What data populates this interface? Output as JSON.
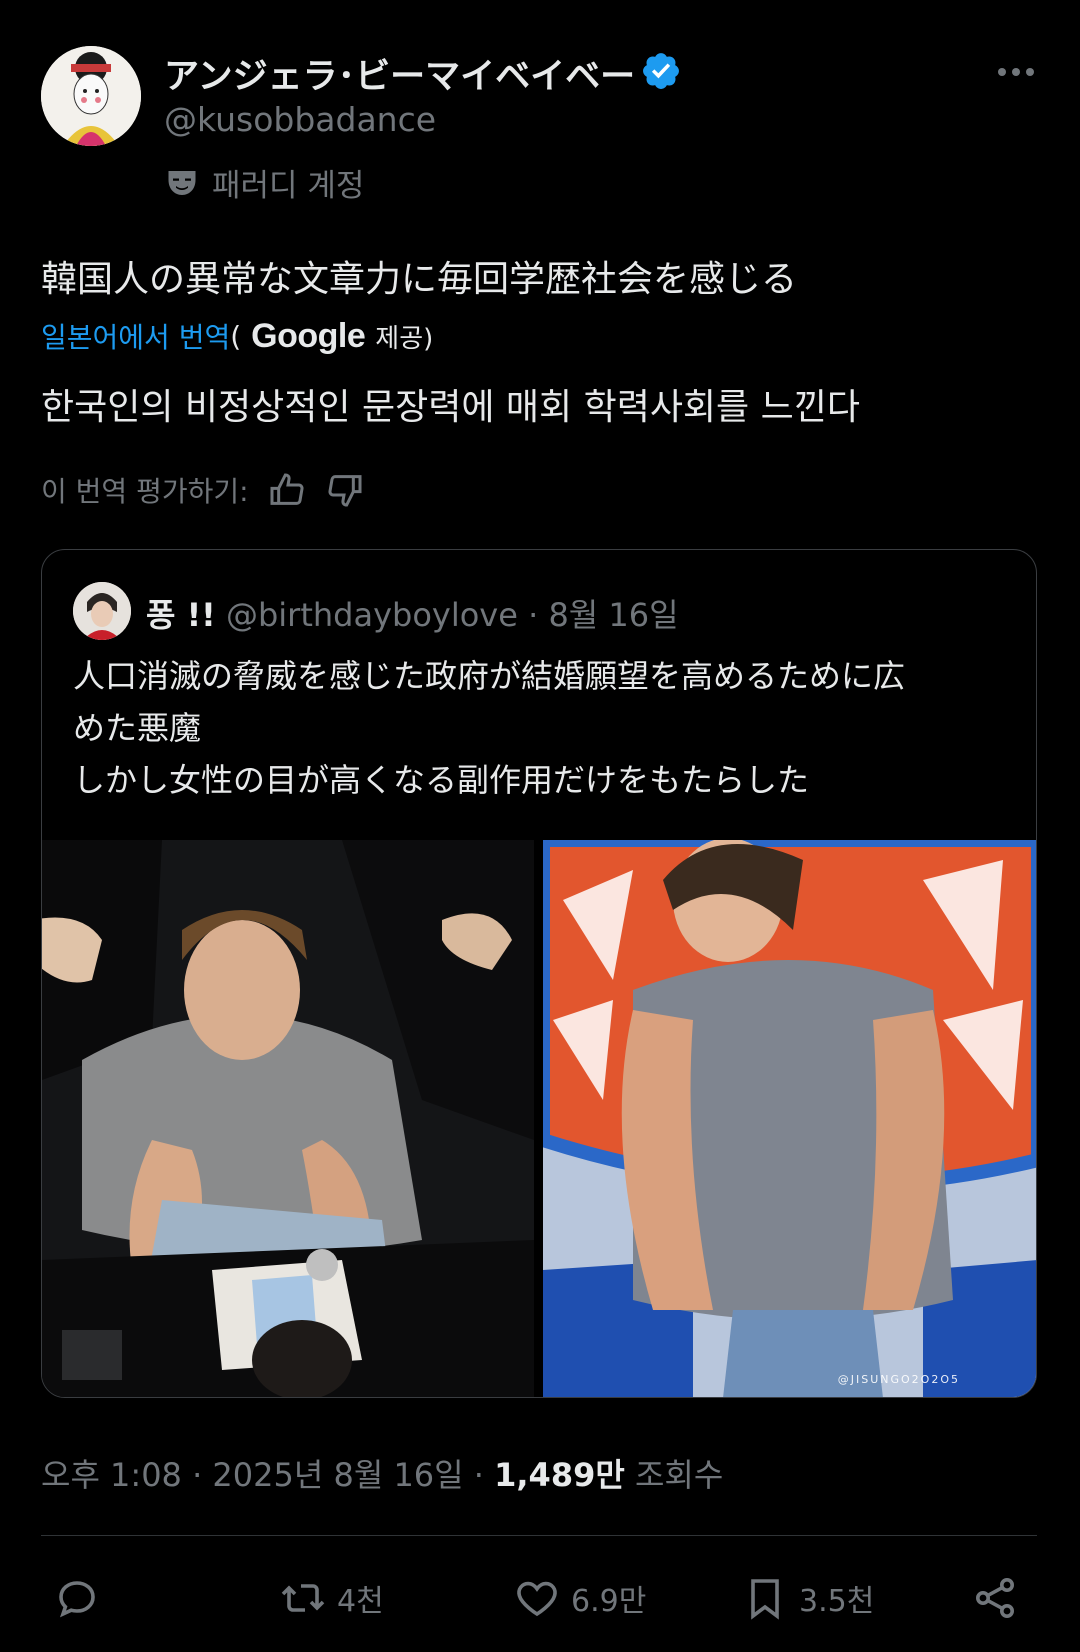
{
  "author": {
    "display_name": "アンジェラ･ビーマイベイベー",
    "handle": "@kusobbadance",
    "parody_label": "패러디 계정"
  },
  "tweet": {
    "text_original": "韓国人の異常な文章力に毎回学歴社会を感じる",
    "translate_link": "일본어에서 번역",
    "translate_open": "(",
    "translate_provider": "Google",
    "translate_provided": "제공)",
    "text_translated": "한국인의 비정상적인 문장력에 매회 학력사회를 느낀다",
    "rate_label": "이 번역 평가하기:"
  },
  "quote": {
    "name": "퐁 !!",
    "handle": "@birthdayboylove",
    "date": "· 8월 16일",
    "lines": [
      "人口消滅の脅威を感じた政府が結婚願望を高めるために広",
      "めた悪魔",
      "しかし女性の目が高くなる副作用だけをもたらした"
    ],
    "watermark": "@JISUNGO2O2O5"
  },
  "meta": {
    "time": "오후 1:08 · 2025년 8월 16일 · ",
    "views_count": "1,489만",
    "views_label": " 조회수"
  },
  "actions": {
    "retweets": "4천",
    "likes": "6.9만",
    "bookmarks": "3.5천"
  },
  "colors": {
    "background": "#000000",
    "text": "#e7e9ea",
    "muted": "#71767b",
    "link": "#1d9bf0",
    "verified": "#1d9bf0"
  }
}
